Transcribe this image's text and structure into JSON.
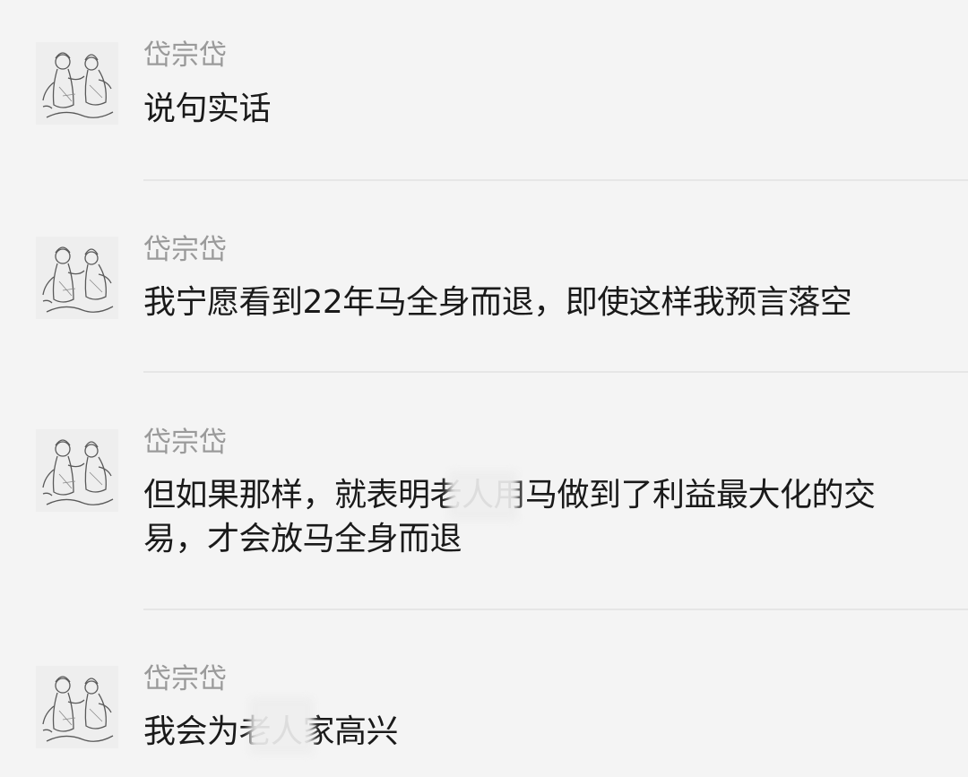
{
  "messages": [
    {
      "author": "岱宗岱",
      "text": "说句实话"
    },
    {
      "author": "岱宗岱",
      "text": "我宁愿看到22年马全身而退，即使这样我预言落空"
    },
    {
      "author": "岱宗岱",
      "text_line1": "但如果那样，就表明老人用马做到了利益最大化的交",
      "text_line2": "易，才会放马全身而退"
    },
    {
      "author": "岱宗岱",
      "text": "我会为老人家高兴"
    }
  ],
  "icons": {
    "avatar": "sketch-avatar-icon"
  }
}
